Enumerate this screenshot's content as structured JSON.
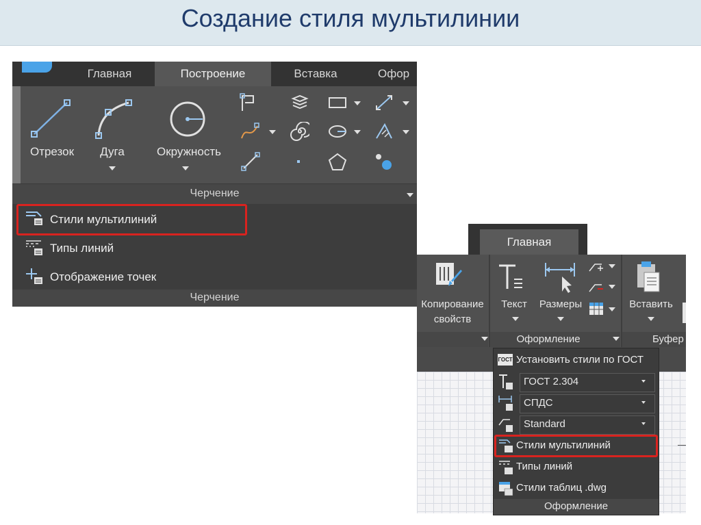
{
  "slide": {
    "title": "Создание стиля мультилинии"
  },
  "panel1": {
    "tabs": [
      "Главная",
      "Построение",
      "Вставка",
      "Офор"
    ],
    "big_buttons": [
      "Отрезок",
      "Дуга",
      "Окружность"
    ],
    "group_label": "Черчение",
    "list_items": [
      "Стили мультилиний",
      "Типы линий",
      "Отображение точек"
    ],
    "footer_label": "Черчение"
  },
  "panel2": {
    "tab": "Главная",
    "buttons": {
      "match_props_line1": "Копирование",
      "match_props_line2": "свойств",
      "text": "Текст",
      "dimensions": "Размеры",
      "paste": "Вставить"
    },
    "group_labels": {
      "annotation": "Оформление",
      "clipboard": "Буфер"
    },
    "dropdown": {
      "set_gost": "Установить стили по ГОСТ",
      "gost_badge": "ГОСТ",
      "text_style": "ГОСТ 2.304",
      "dim_style": "СПДС",
      "leader_style": "Standard",
      "mline_styles": "Стили мультилиний",
      "line_types": "Типы линий",
      "table_styles": "Стили таблиц .dwg",
      "footer": "Оформление"
    }
  },
  "colors": {
    "highlight": "#d9231f",
    "ribbon": "#505050",
    "title": "#1f3b6b",
    "icon_blue": "#7fb2e5"
  },
  "icons": [
    "line-icon",
    "arc-icon",
    "circle-icon",
    "polyline-icon",
    "spline-icon",
    "point-icon",
    "polygon-icon",
    "multiline-style-icon",
    "linetype-icon",
    "point-style-icon",
    "match-properties-icon",
    "text-icon",
    "dimension-icon",
    "paste-icon",
    "table-icon"
  ]
}
